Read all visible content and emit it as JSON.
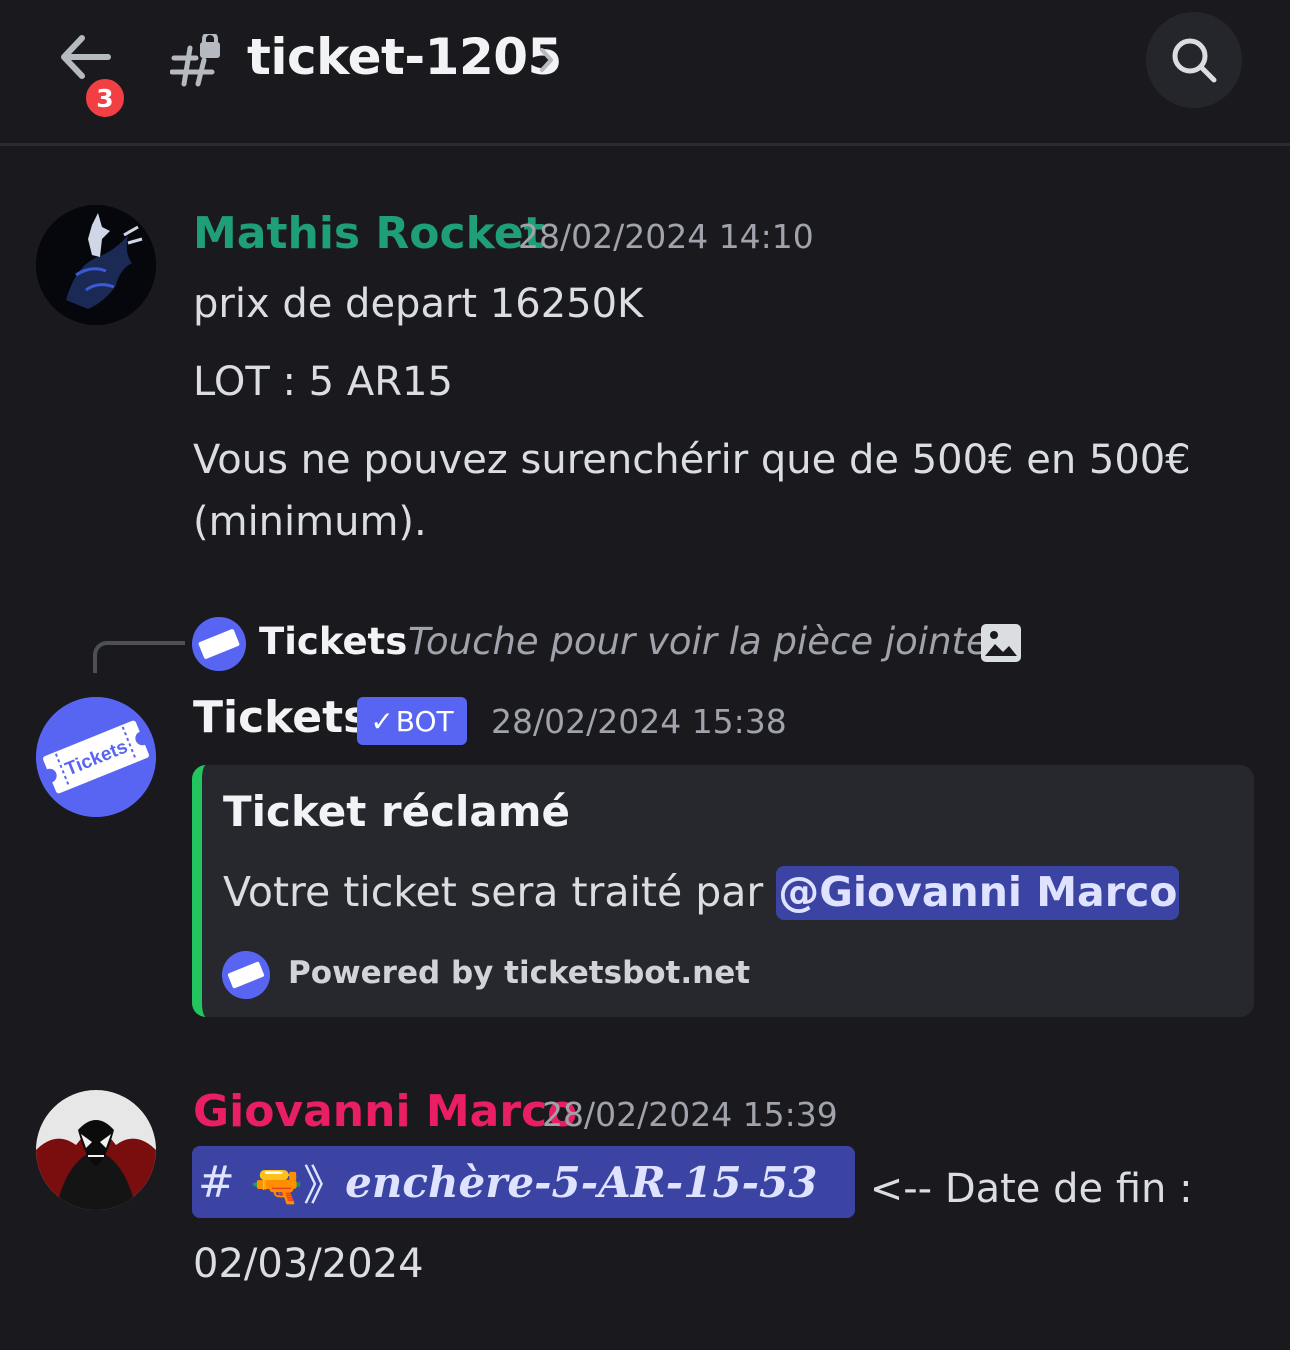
{
  "header": {
    "back_icon": "arrow-left-icon",
    "unread_count": "3",
    "channel_icon": "locked-hash-icon",
    "channel_name": "ticket-1205",
    "chevron": "›",
    "search_icon": "search-icon"
  },
  "messages": [
    {
      "author": "Mathis Rocket",
      "author_color": "#1f9e7a",
      "timestamp": "28/02/2024 14:10",
      "lines": [
        "prix de depart 16250K",
        "LOT : 5 AR15",
        "Vous ne pouvez surenchérir que de 500€ en 500€",
        "(minimum)."
      ]
    },
    {
      "reply": {
        "author": "Tickets",
        "text": "Touche pour voir la pièce jointe",
        "attachment_icon": "image-icon"
      },
      "author": "Tickets",
      "author_color": "#f2f3f5",
      "tag": {
        "check": "✓",
        "label": "BOT"
      },
      "timestamp": "28/02/2024 15:38",
      "embed": {
        "accent": "#23c55e",
        "title": "Ticket réclamé",
        "description_prefix": "Votre ticket sera traité par ",
        "mention": "@Giovanni Marco",
        "footer": "Powered by ticketsbot.net"
      }
    },
    {
      "author": "Giovanni Marco",
      "author_color": "#e91e63",
      "timestamp": "28/02/2024 15:39",
      "channel_link": {
        "hash": "#",
        "emoji": "🔫》",
        "name": "𝒆𝒏𝒄𝒉è𝒓𝒆-5-𝑨𝑹-15-53"
      },
      "after_link": " <-- Date de fin :",
      "line2": "02/03/2024"
    }
  ],
  "logo_text": "Tickets"
}
